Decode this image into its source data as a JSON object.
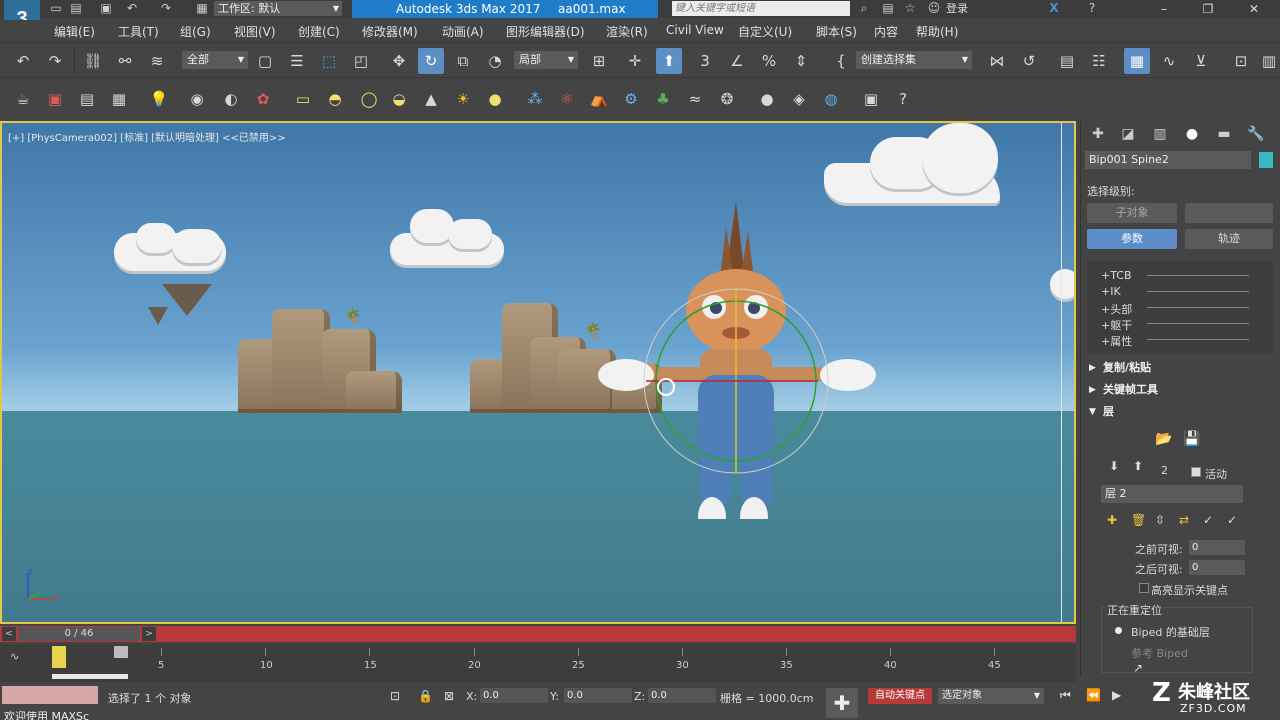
{
  "titlebar": {
    "logo": "3",
    "workspace_label": "工作区: 默认",
    "app_name": "Autodesk 3ds Max 2017",
    "file_name": "aa001.max",
    "search_placeholder": "键入关键字或短语",
    "login_label": "登录",
    "help_label": "?"
  },
  "menu": {
    "items": [
      "编辑(E)",
      "工具(T)",
      "组(G)",
      "视图(V)",
      "创建(C)",
      "修改器(M)",
      "动画(A)",
      "图形编辑器(D)",
      "渲染(R)",
      "Civil View",
      "自定义(U)",
      "脚本(S)",
      "内容",
      "帮助(H)"
    ]
  },
  "toolbar": {
    "filter_label": "全部",
    "coord_label": "局部",
    "selection_set_label": "创建选择集"
  },
  "viewport": {
    "label": "[+] [PhysCamera002] [标准] [默认明暗处理] <<已禁用>>",
    "axis_z": "z",
    "axis_x": "x"
  },
  "timeline": {
    "frame_counter": "0 / 46",
    "ticks": [
      "5",
      "10",
      "15",
      "20",
      "25",
      "30",
      "35",
      "40",
      "45"
    ]
  },
  "status": {
    "welcome": "欢迎使用 MAXSc",
    "selection_info": "选择了 1 个 对象",
    "x_label": "X:",
    "x_value": "0.0",
    "y_label": "Y:",
    "y_value": "0.0",
    "z_label": "Z:",
    "z_value": "0.0",
    "grid_label": "栅格 = 1000.0cm",
    "auto_key": "自动关键点",
    "set_key_mode": "选定对象"
  },
  "cmdpanel": {
    "object_name": "Bip001 Spine2",
    "object_color": "#39b8c4",
    "selection_level_label": "选择级别:",
    "sub_object_button": "子对象",
    "params_button": "参数",
    "trajectory_button": "轨迹",
    "track_items": [
      "+TCB",
      "+IK",
      "+头部",
      "+躯干",
      "+属性"
    ],
    "rollouts": {
      "copy_paste": "复制/粘贴",
      "keyframe_tools": "关键帧工具",
      "layers": "层"
    },
    "layer_number": "2",
    "active_label": "活动",
    "layer_name": "层 2",
    "before_visible_label": "之前可视:",
    "before_visible_value": "0",
    "after_visible_label": "之后可视:",
    "after_visible_value": "0",
    "highlight_keys_label": "高亮显示关键点",
    "retarget_label": "正在重定位",
    "biped_base_label": "Biped 的基础层",
    "ref_biped_label": "参考 Biped"
  },
  "watermark": {
    "name": "朱峰社区",
    "url": "ZF3D.COM"
  }
}
